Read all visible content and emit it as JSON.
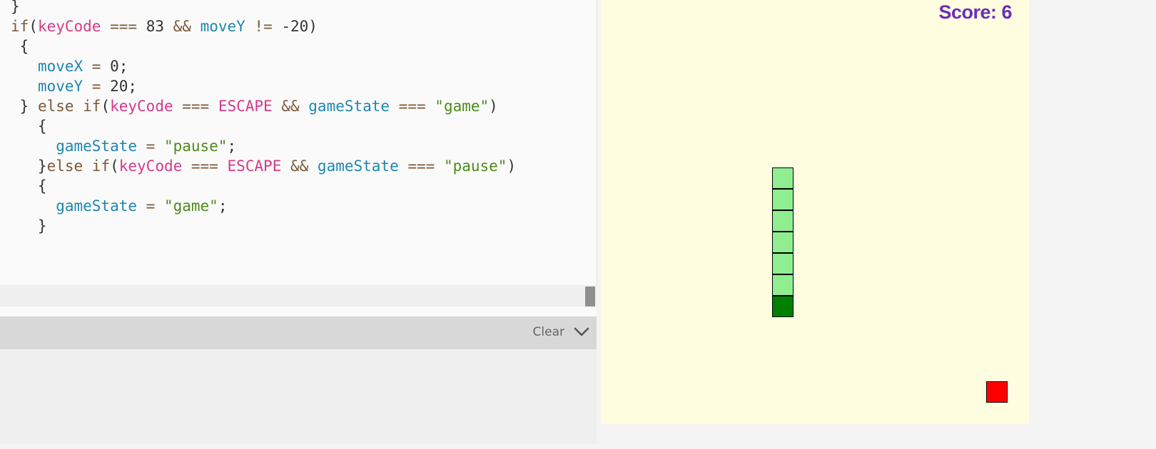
{
  "editor": {
    "lines": [
      [
        {
          "t": "}",
          "c": "plain"
        }
      ],
      [
        {
          "t": "if",
          "c": "kw"
        },
        {
          "t": "(",
          "c": "plain"
        },
        {
          "t": "keyCode",
          "c": "var"
        },
        {
          "t": " === ",
          "c": "op"
        },
        {
          "t": "83",
          "c": "num"
        },
        {
          "t": " && ",
          "c": "op"
        },
        {
          "t": "moveY",
          "c": "ident"
        },
        {
          "t": " != ",
          "c": "op"
        },
        {
          "t": "-20",
          "c": "num"
        },
        {
          "t": ")",
          "c": "plain"
        }
      ],
      [
        {
          "t": " {",
          "c": "plain"
        }
      ],
      [
        {
          "t": "   ",
          "c": "plain"
        },
        {
          "t": "moveX",
          "c": "ident"
        },
        {
          "t": " = ",
          "c": "op"
        },
        {
          "t": "0",
          "c": "num"
        },
        {
          "t": ";",
          "c": "plain"
        }
      ],
      [
        {
          "t": "   ",
          "c": "plain"
        },
        {
          "t": "moveY",
          "c": "ident"
        },
        {
          "t": " = ",
          "c": "op"
        },
        {
          "t": "20",
          "c": "num"
        },
        {
          "t": ";",
          "c": "plain"
        }
      ],
      [
        {
          "t": " } ",
          "c": "plain"
        },
        {
          "t": "else if",
          "c": "kw"
        },
        {
          "t": "(",
          "c": "plain"
        },
        {
          "t": "keyCode",
          "c": "var"
        },
        {
          "t": " === ",
          "c": "op"
        },
        {
          "t": "ESCAPE",
          "c": "var"
        },
        {
          "t": " && ",
          "c": "op"
        },
        {
          "t": "gameState",
          "c": "ident"
        },
        {
          "t": " === ",
          "c": "op"
        },
        {
          "t": "\"game\"",
          "c": "str"
        },
        {
          "t": ")",
          "c": "plain"
        }
      ],
      [
        {
          "t": "   {",
          "c": "plain"
        }
      ],
      [
        {
          "t": "     ",
          "c": "plain"
        },
        {
          "t": "gameState",
          "c": "ident"
        },
        {
          "t": " = ",
          "c": "op"
        },
        {
          "t": "\"pause\"",
          "c": "str"
        },
        {
          "t": ";",
          "c": "plain"
        }
      ],
      [
        {
          "t": "   }",
          "c": "plain"
        },
        {
          "t": "else if",
          "c": "kw"
        },
        {
          "t": "(",
          "c": "plain"
        },
        {
          "t": "keyCode",
          "c": "var"
        },
        {
          "t": " === ",
          "c": "op"
        },
        {
          "t": "ESCAPE",
          "c": "var"
        },
        {
          "t": " && ",
          "c": "op"
        },
        {
          "t": "gameState",
          "c": "ident"
        },
        {
          "t": " === ",
          "c": "op"
        },
        {
          "t": "\"pause\"",
          "c": "str"
        },
        {
          "t": ")",
          "c": "plain"
        }
      ],
      [
        {
          "t": "   {",
          "c": "plain"
        }
      ],
      [
        {
          "t": "     ",
          "c": "plain"
        },
        {
          "t": "gameState",
          "c": "ident"
        },
        {
          "t": " = ",
          "c": "op"
        },
        {
          "t": "\"game\"",
          "c": "str"
        },
        {
          "t": ";",
          "c": "plain"
        }
      ],
      [
        {
          "t": "   }",
          "c": "plain"
        }
      ]
    ]
  },
  "console": {
    "clear_label": "Clear",
    "toggle_icon": "chevron-down-icon"
  },
  "game": {
    "score_text": "Score: 6",
    "colors": {
      "background": "#fffddf",
      "snake_head": "#008000",
      "snake_body": "#90ee90",
      "food": "#ff0000",
      "score": "#6a2eb8"
    }
  }
}
